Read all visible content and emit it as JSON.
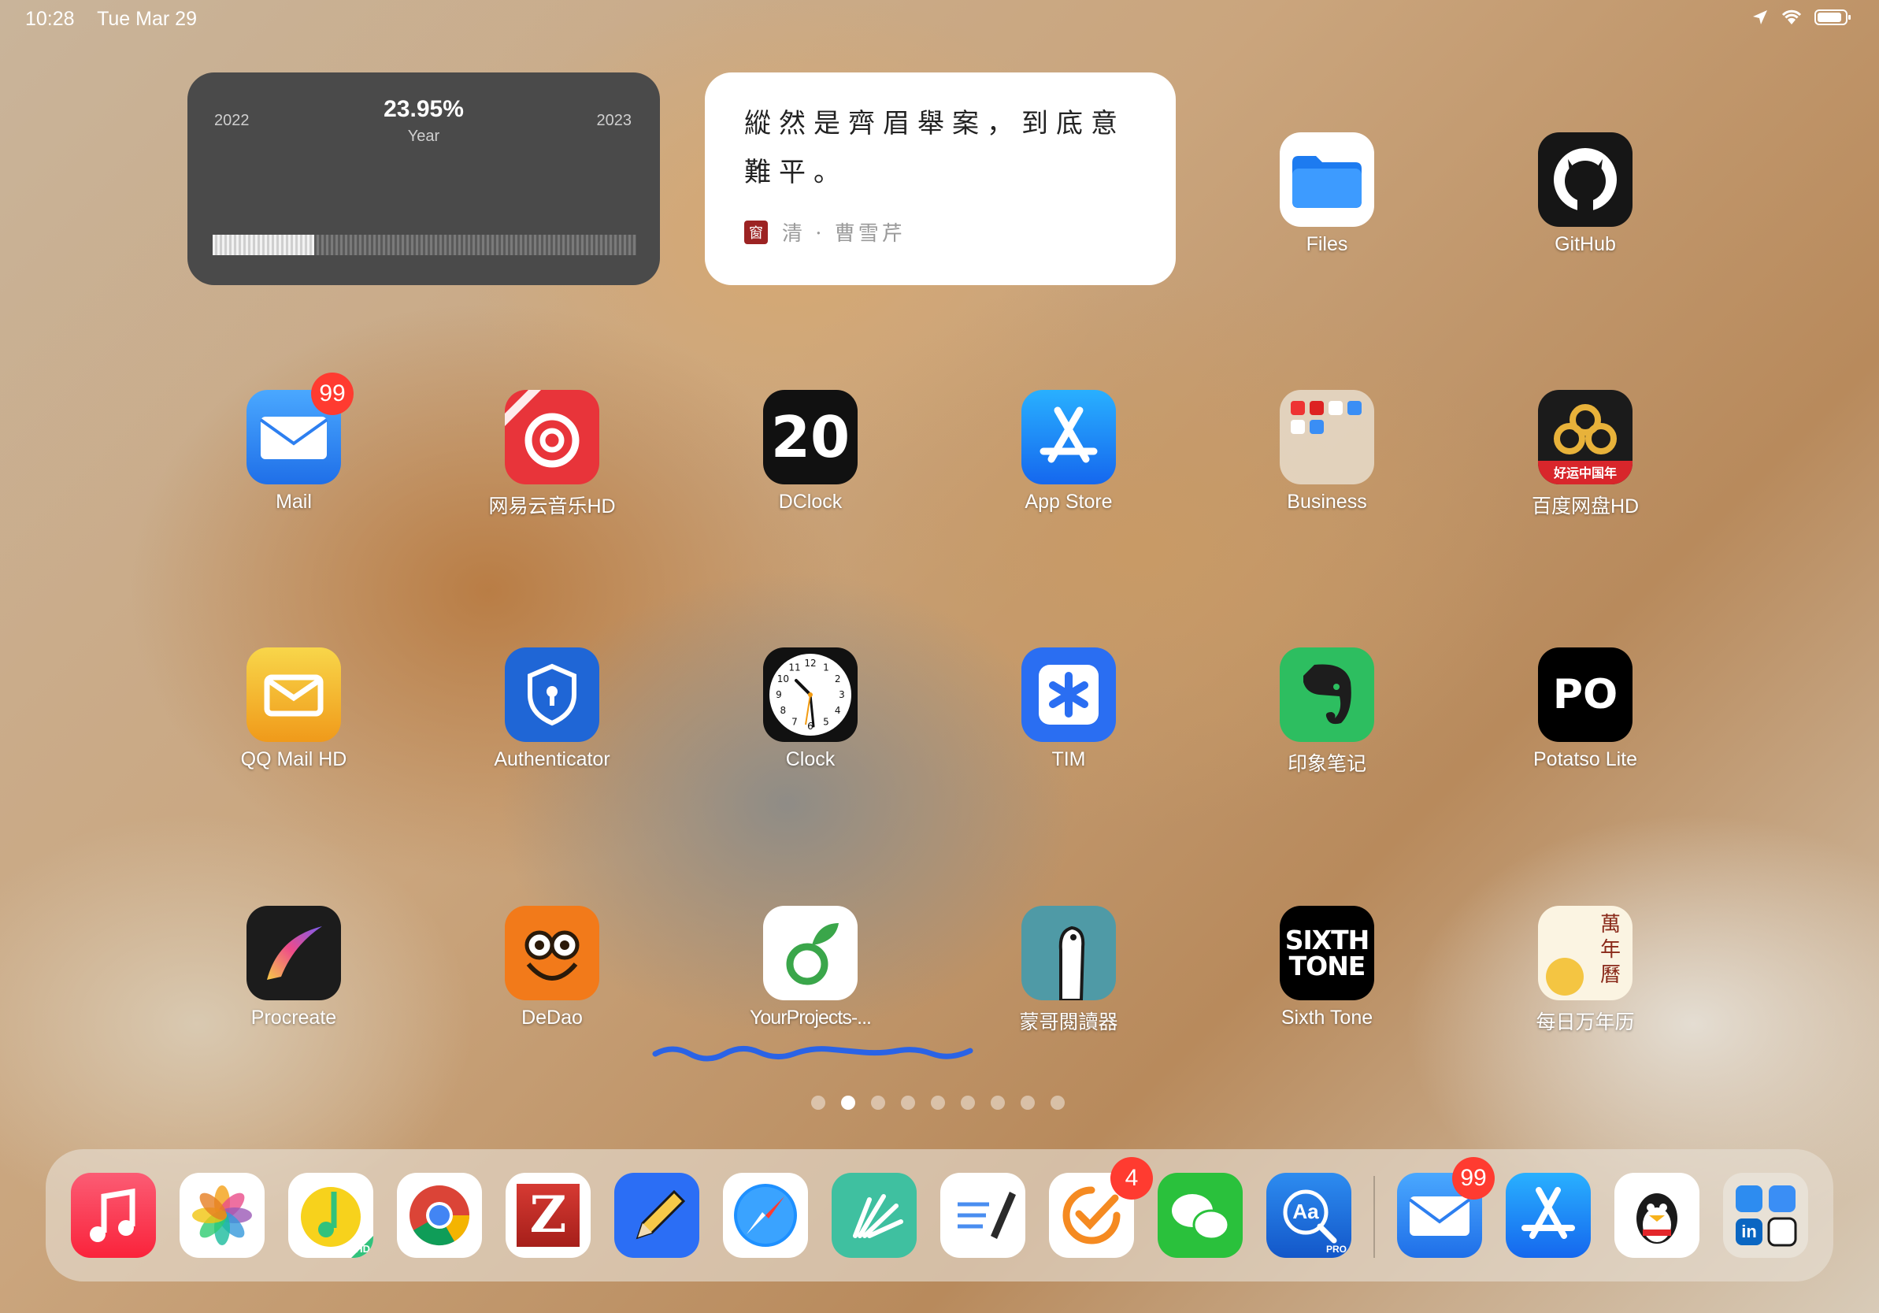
{
  "status_bar": {
    "time": "10:28",
    "date": "Tue Mar 29"
  },
  "year_widget": {
    "start_year": "2022",
    "end_year": "2023",
    "percent": "23.95%",
    "caption": "Year",
    "progress_fraction": 0.2395
  },
  "poem_widget": {
    "text": "縱然是齊眉舉案，到底意難平。",
    "seal": "窗",
    "attribution": "清 · 曹雪芹"
  },
  "apps": [
    {
      "label": "Files",
      "icon": "files-icon",
      "color": "#ffffff"
    },
    {
      "label": "GitHub",
      "icon": "github-icon",
      "color": "#161616"
    },
    {
      "label": "Mail",
      "icon": "mail-icon",
      "color": "#2d8cf0",
      "badge": "99"
    },
    {
      "label": "网易云音乐HD",
      "icon": "netease-music-icon",
      "color": "#e8343a",
      "glyph": "◎"
    },
    {
      "label": "DClock",
      "icon": "dclock-icon",
      "color": "#111111",
      "glyph": "20"
    },
    {
      "label": "App Store",
      "icon": "app-store-icon",
      "color": "#1f8cf0"
    },
    {
      "label": "Business",
      "icon": "folder-icon",
      "color": "#e8dccb"
    },
    {
      "label": "百度网盘HD",
      "icon": "baidu-netdisk-icon",
      "color": "#1b1b1b",
      "sublabel": "好运中国年"
    },
    {
      "label": "QQ Mail HD",
      "icon": "qq-mail-icon",
      "color": "#f3a51b"
    },
    {
      "label": "Authenticator",
      "icon": "authenticator-icon",
      "color": "#1f66d6"
    },
    {
      "label": "Clock",
      "icon": "clock-icon",
      "color": "#111111",
      "clock_numerals": [
        "12",
        "1",
        "2",
        "3",
        "4",
        "5",
        "6",
        "7",
        "8",
        "9",
        "10",
        "11"
      ]
    },
    {
      "label": "TIM",
      "icon": "tim-icon",
      "color": "#2a6ef2"
    },
    {
      "label": "印象笔记",
      "icon": "evernote-icon",
      "color": "#2dbe60"
    },
    {
      "label": "Potatso Lite",
      "icon": "potatso-icon",
      "color": "#000000",
      "glyph": "PO"
    },
    {
      "label": "Procreate",
      "icon": "procreate-icon",
      "color": "#1c1c1c"
    },
    {
      "label": "DeDao",
      "icon": "dedao-owl-icon",
      "color": "#f27a1a"
    },
    {
      "label": "YourProjects-...",
      "icon": "yourprojects-leaf-icon",
      "color": "#ffffff"
    },
    {
      "label": "蒙哥閱讀器",
      "icon": "meerkat-icon",
      "color": "#4f9aa6"
    },
    {
      "label": "Sixth Tone",
      "icon": "sixth-tone-icon",
      "color": "#000000",
      "glyph1": "SIXTH",
      "glyph2": "TONE"
    },
    {
      "label": "每日万年历",
      "icon": "calendar-icon",
      "color": "#fbf4e2",
      "glyph": "萬年曆"
    }
  ],
  "page_dots": {
    "count": 9,
    "active": 1
  },
  "dock": [
    {
      "icon": "music-icon",
      "color": "#fa2d48"
    },
    {
      "icon": "photos-icon",
      "color": "#ffffff"
    },
    {
      "icon": "qq-music-hd-icon",
      "color": "#ffffff",
      "tag": "HD"
    },
    {
      "icon": "chrome-icon",
      "color": "#ffffff"
    },
    {
      "icon": "zotero-icon",
      "color": "#ffffff",
      "glyph": "Z"
    },
    {
      "icon": "pencil-notes-icon",
      "color": "#2b6ef5"
    },
    {
      "icon": "safari-icon",
      "color": "#ffffff"
    },
    {
      "icon": "flowers-icon",
      "color": "#3fc0a0"
    },
    {
      "icon": "notes-pen-icon",
      "color": "#ffffff"
    },
    {
      "icon": "ticktick-icon",
      "color": "#ffffff",
      "badge": "4"
    },
    {
      "icon": "wechat-icon",
      "color": "#2ac13c"
    },
    {
      "icon": "dictionary-icon",
      "color": "#1f6ee8",
      "glyph": "Aa",
      "tag": "PRO"
    },
    {
      "icon": "mail-icon",
      "color": "#2d8cf0",
      "badge": "99"
    },
    {
      "icon": "app-store-icon",
      "color": "#1f8cf0"
    },
    {
      "icon": "qq-penguin-icon",
      "color": "#ffffff"
    },
    {
      "icon": "app-library-icon",
      "color": "#e9e2d8",
      "glyph": "in"
    }
  ]
}
